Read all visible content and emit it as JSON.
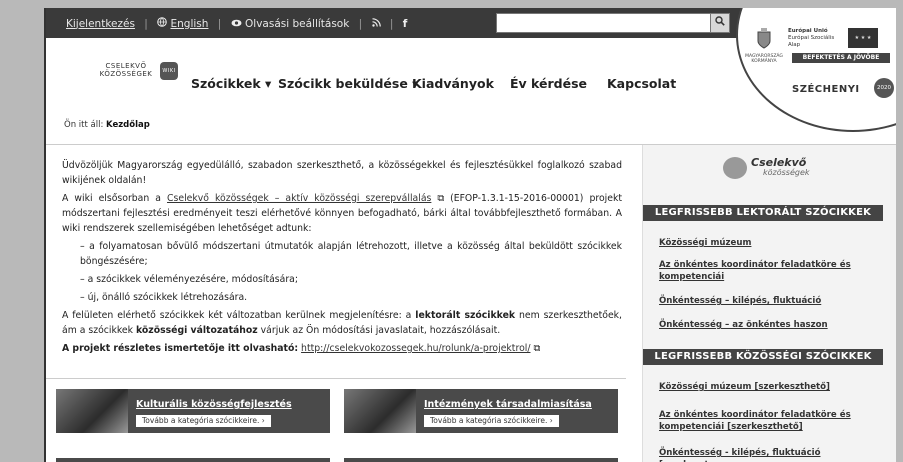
{
  "topbar": {
    "links": [
      "Kijelentkezés",
      "English",
      "Olvasási beállítások"
    ],
    "icons": [
      "globe-icon",
      "eye-icon",
      "rss-icon",
      "facebook-icon"
    ],
    "search_placeholder": ""
  },
  "eu_badge": {
    "line1": "Európai Unió",
    "line2": "Európai Szociális",
    "line3": "Alap",
    "gov": "MAGYARORSZÁG KORMÁNYA",
    "slogan": "BEFEKTETÉS A JÖVŐBE",
    "program": "SZÉCHENYI",
    "year": "2020"
  },
  "logo": {
    "line1": "CSELEKVŐ",
    "line2": "KÖZÖSSÉGEK",
    "badge": "WIKI"
  },
  "nav": {
    "items": [
      "Szócikkek ▾",
      "Szócikk beküldése ▾",
      "Kiadványok",
      "Év kérdése",
      "Kapcsolat"
    ]
  },
  "breadcrumb": {
    "prefix": "Ön itt áll:",
    "current": "Kezdőlap"
  },
  "main": {
    "p1": "Üdvözöljük Magyarország egyedülálló, szabadon szerkeszthető, a közösségekkel és fejlesztésükkel foglalkozó szabad wikijének oldalán!",
    "p2_before": "A wiki elsősorban a ",
    "p2_link": "Cselekvő közösségek – aktív közösségi szerepvállalás",
    "p2_after": " (EFOP-1.3.1-15-2016-00001) projekt módszertani fejlesztési eredményeit teszi elérhetővé könnyen befogadható, bárki által továbbfejleszthető formában. A wiki rendszerek szellemiségében lehetőséget adtunk:",
    "list": [
      "– a folyamatosan bővülő módszertani útmutatók alapján létrehozott, illetve a közösség által beküldött szócikkek böngészésére;",
      "– a szócikkek véleményezésére, módosítására;",
      "– új, önálló szócikkek létrehozására."
    ],
    "p3_a": "A felületen elérhető szócikkek két változatban kerülnek megjelenítésre: a ",
    "p3_b": "lektorált szócikkek",
    "p3_c": " nem szerkeszthetőek, ám a szócikkek ",
    "p3_d": "közösségi változatához",
    "p3_e": " várjuk az Ön módosítási javaslatait, hozzászólásait.",
    "p4_label": "A projekt részletes ismertetője itt olvasható:",
    "p4_link": "http://cselekvokozossegek.hu/rolunk/a-projektrol/"
  },
  "categories": [
    {
      "title": "Kulturális közösségfejlesztés",
      "button": "Tovább a kategória szócikkeire. ›"
    },
    {
      "title": "Intézmények társadalmiasítása",
      "button": "Tovább a kategória szócikkeire. ›"
    }
  ],
  "sidebar": {
    "logo_a": "Cselekvő",
    "logo_b": "közösségek",
    "h1": "LEGFRISSEBB LEKTORÁLT SZÓCIKKEK",
    "list1": [
      "Közösségi múzeum",
      "Az önkéntes koordinátor feladatköre és kompetenciái",
      "Önkéntesség – kilépés, fluktuáció",
      "Önkéntesség – az önkéntes haszon"
    ],
    "h2": "LEGFRISSEBB KÖZÖSSÉGI SZÓCIKKEK",
    "list2": [
      "Közösségi múzeum [szerkeszthető]",
      "Az önkéntes koordinátor feladatköre és kompetenciái [szerkeszthető]",
      "Önkéntesség - kilépés, fluktuáció [szerkeszt-"
    ]
  }
}
